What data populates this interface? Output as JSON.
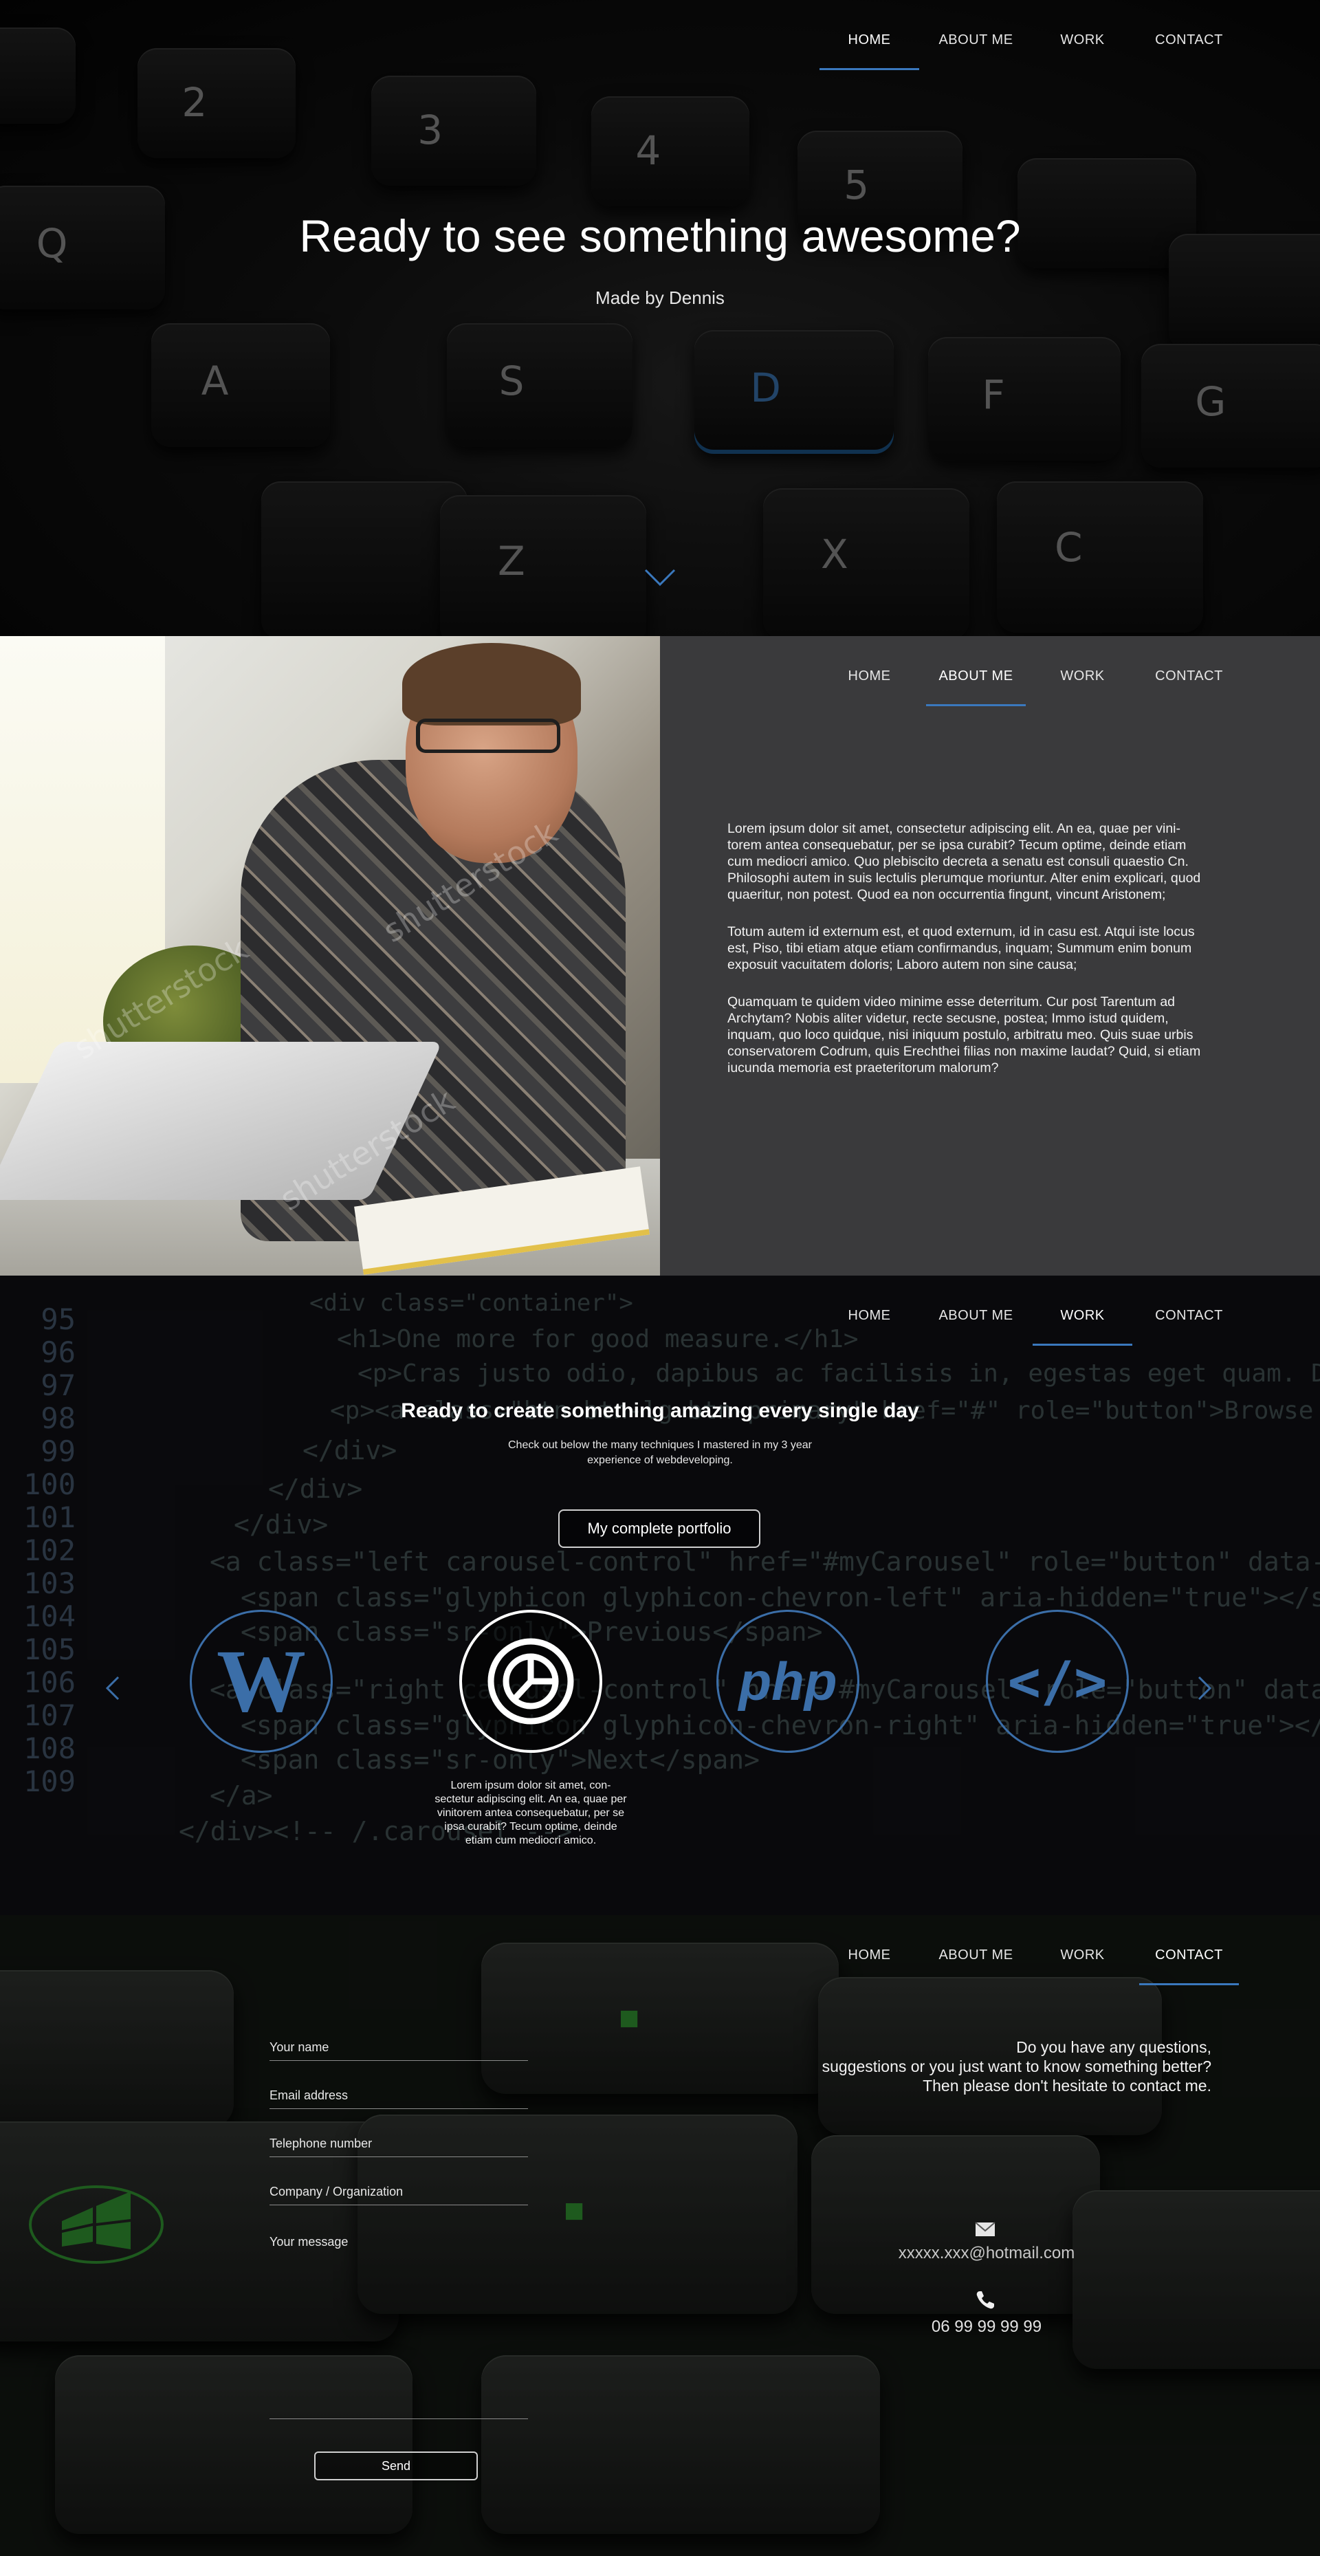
{
  "nav": {
    "home": "HOME",
    "about": "ABOUT ME",
    "work": "WORK",
    "contact": "CONTACT"
  },
  "hero": {
    "title": "Ready to see something awesome?",
    "subtitle": "Made by Dennis",
    "keys": [
      "Q",
      "A",
      "S",
      "D",
      "F",
      "G",
      "Z",
      "X",
      "C",
      "2",
      "3",
      "4",
      "5"
    ],
    "highlighted_key": "D",
    "accent_color": "#3a78bd"
  },
  "about": {
    "paragraphs": [
      "Lorem ipsum dolor sit amet, consectetur adipiscing elit. An ea, quae per vini-torem antea consequebatur, per se ipsa curabit? Tecum optime, deinde etiam cum mediocri amico. Quo plebiscito decreta a senatu est consuli quaestio Cn. Philosophi autem in suis lectulis plerumque moriuntur. Alter enim explicari, quod quaeritur, non potest. Quod ea non occurrentia fingunt, vincunt Aristonem;",
      "Totum autem id externum est, et quod externum, id in casu est. Atqui iste locus est, Piso, tibi etiam atque etiam confirmandus, inquam; Summum enim bonum exposuit vacuitatem doloris; Laboro autem non sine causa;",
      "Quamquam te quidem video minime esse deterritum. Cur post Tarentum ad Archytam? Nobis aliter videtur, recte secusne, postea; Immo istud quidem, inquam, quo loco quidque, nisi iniquum postulo, arbitratu meo. Quis suae urbis conservatorem Codrum, quis Erechthei filias non maxime laudat? Quid, si etiam iucunda memoria est praeteritorum malorum?"
    ],
    "watermark": "shutterstock"
  },
  "work": {
    "title": "Ready to create something amazing every single day",
    "subtitle": "Check out below the many techniques I mastered in my 3 year experience of webdeveloping.",
    "portfolio_button": "My complete portfolio",
    "line_numbers": [
      "95",
      "96",
      "97",
      "98",
      "99",
      "100",
      "101",
      "102",
      "103",
      "104",
      "105",
      "106",
      "107",
      "108",
      "109"
    ],
    "code_lines": [
      "<div class=\"container\">",
      "<h1>One more for good measure.</h1>",
      "<p>Cras justo odio, dapibus ac facilisis in, egestas eget quam. Donec id elit non mi porta gravida at eget metus.",
      "<p><a class=\"btn btn-lg btn-primary\" href=\"#\" role=\"button\">Browse gallery</a></p>",
      "</div>",
      "</div>",
      "</div>",
      "<a class=\"left carousel-control\" href=\"#myCarousel\" role=\"button\" data-slide=\"prev\">",
      "<span class=\"glyphicon glyphicon-chevron-left\" aria-hidden=\"true\"></span>",
      "<span class=\"sr-only\">Previous</span>",
      "<a class=\"right carousel-control\" href=\"#myCarousel\" role=\"button\" data-slide=\"next\">",
      "<span class=\"glyphicon glyphicon-chevron-right\" aria-hidden=\"true\"></span>",
      "<span class=\"sr-only\">Next</span>",
      "</a>",
      "</div><!-- /.carousel -->"
    ],
    "skills": [
      {
        "name": "wordpress",
        "label": "W"
      },
      {
        "name": "analytics",
        "label": ""
      },
      {
        "name": "php",
        "label": "php"
      },
      {
        "name": "code",
        "label": "</>"
      }
    ],
    "active_caption": "Lorem ipsum dolor sit amet, con-sectetur adipiscing elit. An ea, quae per vinitorem antea consequebatur, per se ipsa curabit? Tecum optime, deinde etiam cum mediocri amico.",
    "icon_color": "#3b6ea8"
  },
  "contact": {
    "form": {
      "name": "Your name",
      "email": "Email address",
      "phone": "Telephone number",
      "company": "Company / Organization",
      "message": "Your message",
      "send": "Send"
    },
    "intro_lines": [
      "Do you have any questions,",
      "suggestions or you just want to know something better?",
      "Then please don't hesitate to contact me."
    ],
    "email": "xxxxx.xxx@hotmail.com",
    "phone": "06 99 99 99 99",
    "green_accent": "#2e8b2e"
  }
}
